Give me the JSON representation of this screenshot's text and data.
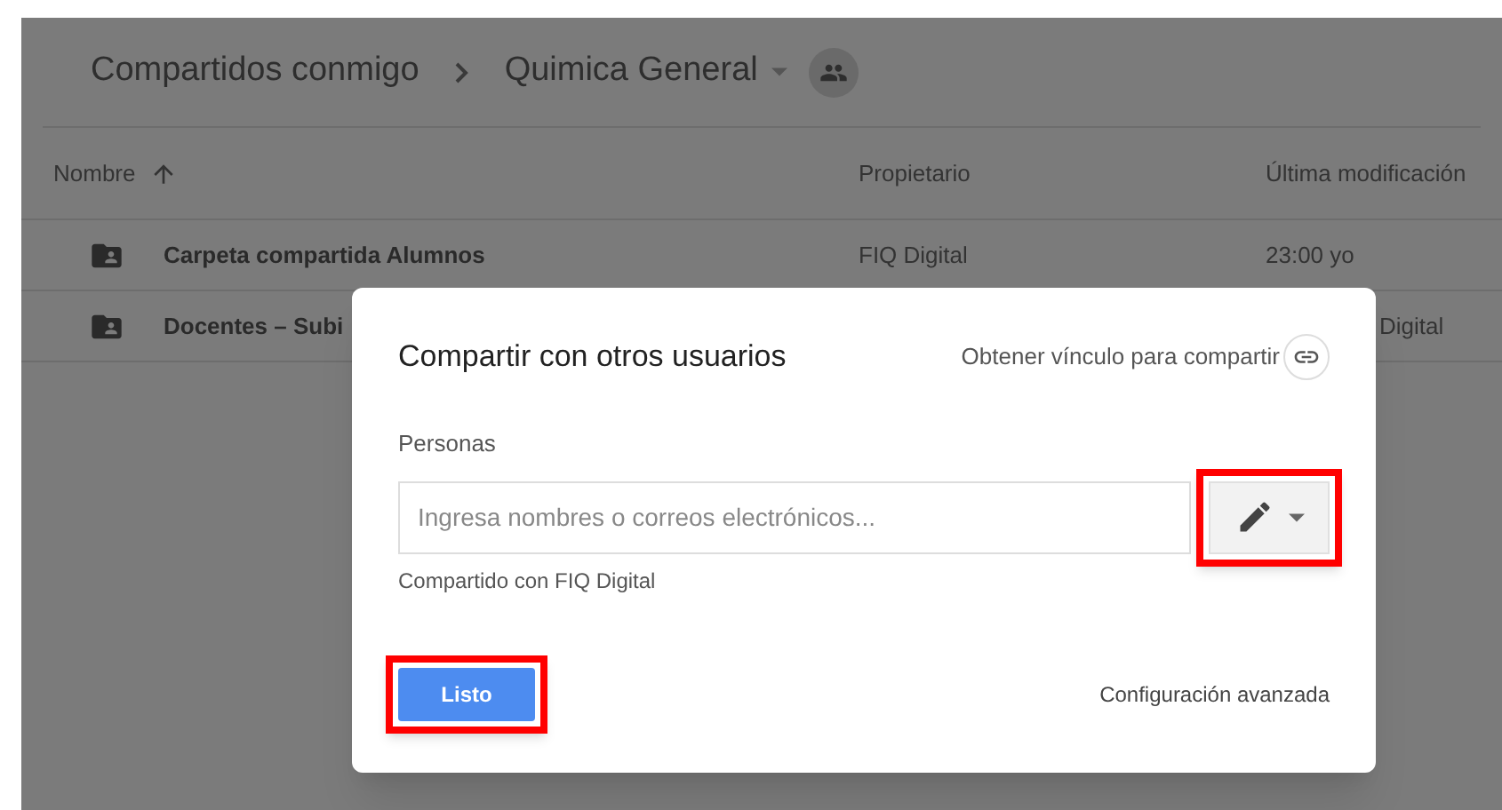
{
  "breadcrumb": {
    "parent": "Compartidos conmigo",
    "current": "Quimica General"
  },
  "table": {
    "columns": [
      "Nombre",
      "Propietario",
      "Última modificación"
    ],
    "rows": [
      {
        "name": "Carpeta compartida Alumnos",
        "owner": "FIQ Digital",
        "modified": "23:00 yo"
      },
      {
        "name": "Docentes – Subi",
        "modified": "Digital"
      }
    ]
  },
  "dialog": {
    "title": "Compartir con otros usuarios",
    "link": "Obtener vínculo para compartir",
    "people_label": "Personas",
    "input": {
      "placeholder": "Ingresa nombres o correos electrónicos..."
    },
    "permission_button": {
      "highlighted": true
    },
    "shared_with": "Compartido con FIQ Digital",
    "done_button": {
      "label": "Listo",
      "highlighted": true
    },
    "advanced": "Configuración avanzada"
  }
}
